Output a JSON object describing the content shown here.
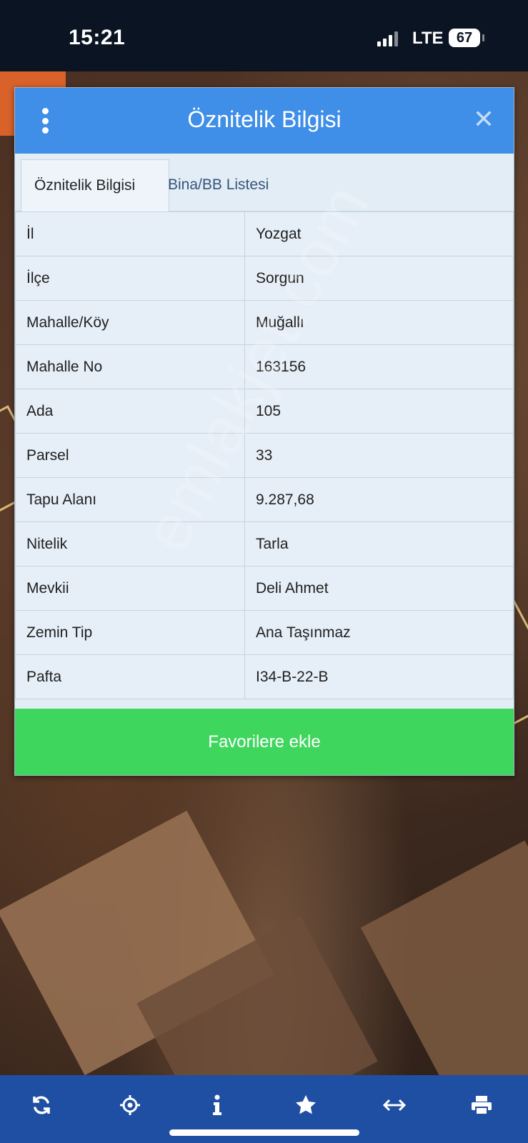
{
  "status_bar": {
    "time": "15:21",
    "network": "LTE",
    "battery": "67"
  },
  "dialog": {
    "title": "Öznitelik Bilgisi",
    "tabs": [
      {
        "label": "Öznitelik Bilgisi",
        "active": true
      },
      {
        "label": "Bina/BB Listesi",
        "active": false
      }
    ],
    "rows": [
      {
        "key": "İl",
        "value": "Yozgat"
      },
      {
        "key": "İlçe",
        "value": "Sorgun"
      },
      {
        "key": "Mahalle/Köy",
        "value": "Muğallı"
      },
      {
        "key": "Mahalle No",
        "value": "163156"
      },
      {
        "key": "Ada",
        "value": "105"
      },
      {
        "key": "Parsel",
        "value": "33"
      },
      {
        "key": "Tapu Alanı",
        "value": "9.287,68"
      },
      {
        "key": "Nitelik",
        "value": "Tarla"
      },
      {
        "key": "Mevkii",
        "value": "Deli Ahmet"
      },
      {
        "key": "Zemin Tip",
        "value": "Ana Taşınmaz"
      },
      {
        "key": "Pafta",
        "value": "I34-B-22-B"
      }
    ],
    "favorite_label": "Favorilere ekle"
  },
  "watermark": "emlakjet.com",
  "bottom_bar": {
    "icons": [
      "refresh-icon",
      "locate-icon",
      "info-icon",
      "star-icon",
      "measure-icon",
      "print-icon"
    ]
  },
  "colors": {
    "header": "#3f8ee8",
    "favorite_button": "#3fd65e",
    "bottom_bar": "#1f4fa3"
  }
}
